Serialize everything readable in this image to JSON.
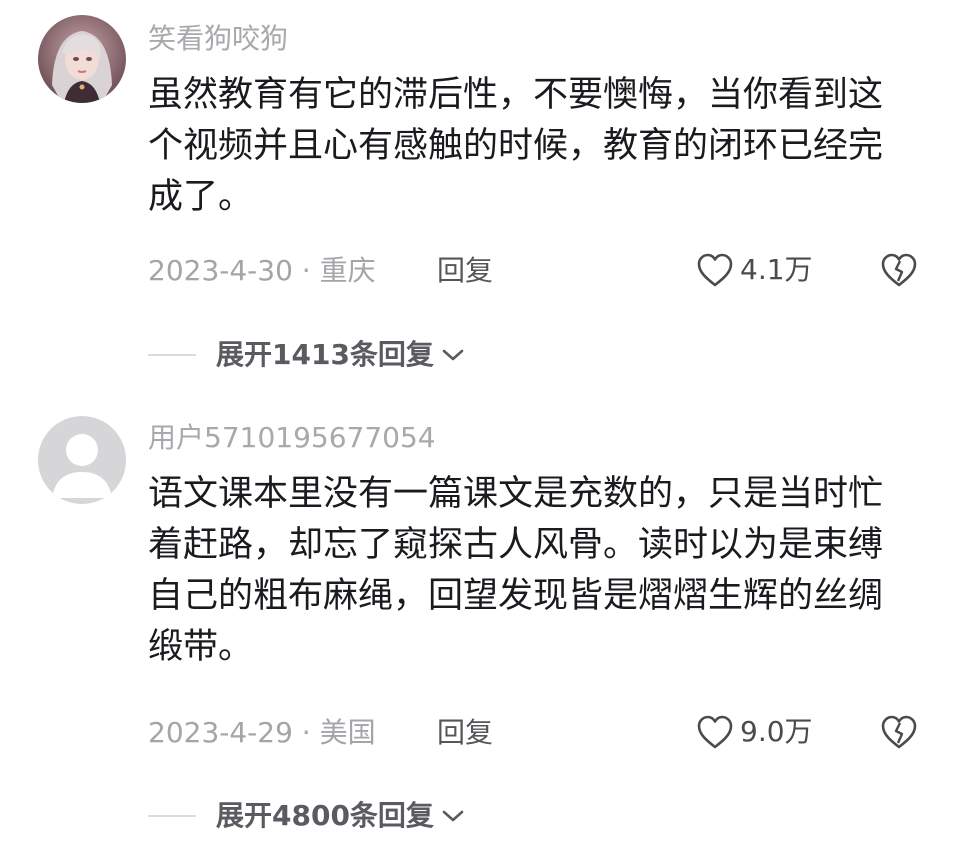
{
  "comments": [
    {
      "username": "笑看狗咬狗",
      "avatar": "avatar-photo",
      "lines": [
        "虽然教育有它的滞后性，不要懊悔，当你看到这",
        "个视频并且心有感触的时候，教育的闭环已经完",
        "成了。"
      ],
      "meta": "2023-4-30 · 重庆",
      "reply_label": "回复",
      "like_count": "4.1万",
      "expand_label": "展开1413条回复"
    },
    {
      "username": "用户5710195677054",
      "avatar": "default-avatar",
      "lines": [
        "语文课本里没有一篇课文是充数的，只是当时忙",
        "着赶路，却忘了窥探古人风骨。读时以为是束缚",
        "自己的粗布麻绳，回望发现皆是熠熠生辉的丝绸",
        "缎带。"
      ],
      "meta": "2023-4-29 · 美国",
      "reply_label": "回复",
      "like_count": "9.0万",
      "expand_label": "展开4800条回复"
    }
  ],
  "icons": {
    "like": "heart-outline-icon",
    "dislike": "broken-heart-icon",
    "expand": "chevron-down-icon"
  }
}
